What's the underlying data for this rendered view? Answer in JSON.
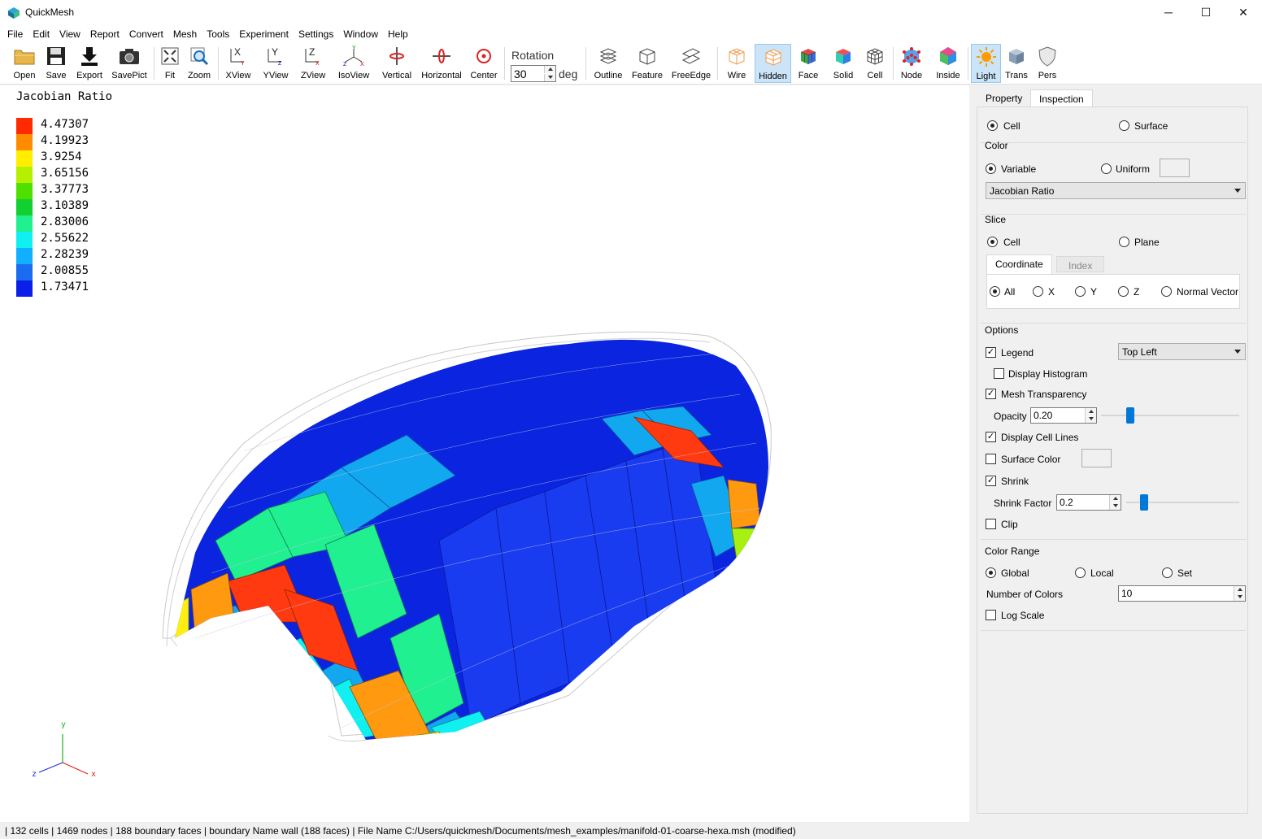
{
  "window": {
    "title": "QuickMesh",
    "minimize_glyph": "─",
    "maximize_glyph": "☐",
    "close_glyph": "✕"
  },
  "menu": [
    "File",
    "Edit",
    "View",
    "Report",
    "Convert",
    "Mesh",
    "Tools",
    "Experiment",
    "Settings",
    "Window",
    "Help"
  ],
  "toolbar": {
    "open": "Open",
    "save": "Save",
    "export": "Export",
    "savepict": "SavePict",
    "fit": "Fit",
    "zoom": "Zoom",
    "xview": "XView",
    "yview": "YView",
    "zview": "ZView",
    "isoview": "IsoView",
    "vertical": "Vertical",
    "horizontal": "Horizontal",
    "center": "Center",
    "rotation_label": "Rotation",
    "rotation_value": "30",
    "rotation_unit": "deg",
    "outline": "Outline",
    "feature": "Feature",
    "freeedge": "FreeEdge",
    "wire": "Wire",
    "hidden": "Hidden",
    "face": "Face",
    "solid": "Solid",
    "cell": "Cell",
    "node": "Node",
    "inside": "Inside",
    "light": "Light",
    "trans": "Trans",
    "pers": "Pers"
  },
  "legend": {
    "title": "Jacobian Ratio",
    "entries": [
      {
        "value": "4.47307",
        "color": "#ff2a00"
      },
      {
        "value": "4.19923",
        "color": "#ff8c00"
      },
      {
        "value": "3.9254",
        "color": "#ffee00"
      },
      {
        "value": "3.65156",
        "color": "#b5f000"
      },
      {
        "value": "3.37773",
        "color": "#50e000"
      },
      {
        "value": "3.10389",
        "color": "#12d030"
      },
      {
        "value": "2.83006",
        "color": "#20f090"
      },
      {
        "value": "2.55622",
        "color": "#10f0f0"
      },
      {
        "value": "2.28239",
        "color": "#10b0ff"
      },
      {
        "value": "2.00855",
        "color": "#1a6cf0"
      },
      {
        "value": "1.73471",
        "color": "#0a20e8"
      }
    ]
  },
  "axes": {
    "x": "x",
    "y": "y",
    "z": "z"
  },
  "panel": {
    "tabs": [
      "Property",
      "Inspection"
    ],
    "mode_cell": "Cell",
    "mode_surface": "Surface",
    "color_title": "Color",
    "color_variable": "Variable",
    "color_uniform": "Uniform",
    "variable_select": "Jacobian Ratio",
    "slice_title": "Slice",
    "slice_cell": "Cell",
    "slice_plane": "Plane",
    "subtabs": [
      "Coordinate",
      "Index"
    ],
    "coord_all": "All",
    "coord_x": "X",
    "coord_y": "Y",
    "coord_z": "Z",
    "coord_normal": "Normal Vector",
    "options_title": "Options",
    "legend": "Legend",
    "legend_position": "Top Left",
    "display_histogram": "Display Histogram",
    "mesh_transparency": "Mesh Transparency",
    "opacity_label": "Opacity",
    "opacity_value": "0.20",
    "display_cell_lines": "Display Cell Lines",
    "surface_color": "Surface Color",
    "shrink": "Shrink",
    "shrink_factor_label": "Shrink Factor",
    "shrink_factor_value": "0.2",
    "clip": "Clip",
    "color_range_title": "Color Range",
    "range_global": "Global",
    "range_local": "Local",
    "range_set": "Set",
    "num_colors_label": "Number of Colors",
    "num_colors_value": "10",
    "log_scale": "Log Scale"
  },
  "status": "| 132 cells | 1469 nodes | 188 boundary faces |  boundary Name wall (188 faces) | File Name C:/Users/quickmesh/Documents/mesh_examples/manifold-01-coarse-hexa.msh (modified)"
}
